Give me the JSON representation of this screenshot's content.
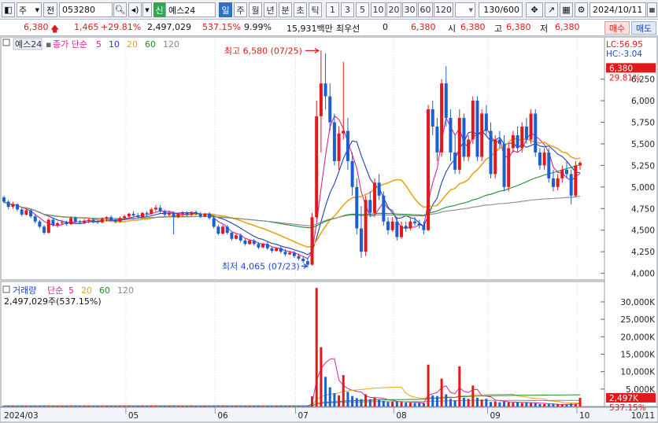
{
  "toolbar": {
    "market": "주",
    "jeon": "전",
    "code": "053280",
    "badge_new": "신",
    "name": "예스24",
    "periods": [
      "일",
      "주",
      "월",
      "년",
      "분",
      "초",
      "틱"
    ],
    "minutes": [
      "1",
      "3",
      "5",
      "10",
      "20",
      "30",
      "60",
      "120"
    ],
    "count": "130/600",
    "date": "2024/10/11"
  },
  "info": {
    "price": "6,380",
    "change": "1,465",
    "change_pct": "+29.81%",
    "volume": "2,497,029",
    "vol_pct": "537.15%",
    "turnover": "9.99%",
    "amount": "15,931백만",
    "best_bid_label": "최우선",
    "best_bid": "0",
    "best_ask": "6,380",
    "open_label": "시",
    "open": "6,380",
    "high_label": "고",
    "high": "6,380",
    "low_label": "저",
    "low": "6,380",
    "buy": "매수",
    "sell": "매도"
  },
  "price_panel": {
    "title": "예스24",
    "legend_prefix": "종가 단순",
    "ma_periods": [
      "5",
      "10",
      "20",
      "60",
      "120"
    ],
    "ma_colors": [
      "#d0269a",
      "#1c3fbf",
      "#e6a617",
      "#1d8f2c",
      "#8a8a8a"
    ],
    "lc": "LC:56.95",
    "hc": "HC:-3.04",
    "last_label": "6,380",
    "pct_label": "29.81%",
    "high_annot": "최고 6,580 (07/25)",
    "low_annot": "최저 4,065 (07/23)"
  },
  "volume_panel": {
    "title": "거래량",
    "legend_prefix": "단순",
    "ma_periods": [
      "5",
      "20",
      "60",
      "120"
    ],
    "ma_colors": [
      "#d0269a",
      "#e6a617",
      "#1d8f2c",
      "#8a8a8a"
    ],
    "volume_text": "2,497,029주(537.15%)",
    "last_label": "2,497K",
    "pct_label": "537.15%"
  },
  "x_axis": {
    "labels": [
      "2024/03",
      "05",
      "06",
      "07",
      "08",
      "09",
      "10"
    ],
    "right": "10/11"
  },
  "chart_data": [
    {
      "type": "candlestick",
      "title": "예스24",
      "y_ticks": [
        "6,250",
        "6,000",
        "5,750",
        "5,500",
        "5,250",
        "5,000",
        "4,750",
        "4,500",
        "4,250",
        "4,000"
      ],
      "ylim": [
        3960,
        6620
      ],
      "up_color": "#e0191b",
      "down_color": "#1c5fd0",
      "candles": [
        [
          4880,
          4900,
          4810,
          4830
        ],
        [
          4830,
          4850,
          4740,
          4770
        ],
        [
          4770,
          4830,
          4750,
          4800
        ],
        [
          4800,
          4810,
          4720,
          4740
        ],
        [
          4740,
          4760,
          4660,
          4680
        ],
        [
          4680,
          4750,
          4670,
          4730
        ],
        [
          4730,
          4740,
          4640,
          4660
        ],
        [
          4660,
          4680,
          4580,
          4600
        ],
        [
          4600,
          4620,
          4520,
          4540
        ],
        [
          4540,
          4560,
          4450,
          4470
        ],
        [
          4470,
          4640,
          4460,
          4620
        ],
        [
          4620,
          4640,
          4540,
          4560
        ],
        [
          4560,
          4600,
          4530,
          4580
        ],
        [
          4580,
          4620,
          4560,
          4590
        ],
        [
          4590,
          4610,
          4550,
          4570
        ],
        [
          4570,
          4660,
          4560,
          4640
        ],
        [
          4640,
          4660,
          4580,
          4600
        ],
        [
          4600,
          4620,
          4570,
          4590
        ],
        [
          4590,
          4630,
          4570,
          4610
        ],
        [
          4610,
          4640,
          4580,
          4620
        ],
        [
          4620,
          4640,
          4580,
          4600
        ],
        [
          4600,
          4620,
          4570,
          4590
        ],
        [
          4590,
          4650,
          4580,
          4630
        ],
        [
          4630,
          4660,
          4600,
          4650
        ],
        [
          4650,
          4670,
          4600,
          4620
        ],
        [
          4620,
          4640,
          4580,
          4600
        ],
        [
          4600,
          4660,
          4590,
          4640
        ],
        [
          4640,
          4680,
          4620,
          4660
        ],
        [
          4660,
          4700,
          4640,
          4690
        ],
        [
          4690,
          4720,
          4650,
          4670
        ],
        [
          4670,
          4700,
          4630,
          4650
        ],
        [
          4650,
          4710,
          4640,
          4700
        ],
        [
          4700,
          4720,
          4660,
          4690
        ],
        [
          4690,
          4760,
          4680,
          4740
        ],
        [
          4740,
          4790,
          4720,
          4760
        ],
        [
          4760,
          4790,
          4700,
          4720
        ],
        [
          4720,
          4740,
          4660,
          4680
        ],
        [
          4680,
          4720,
          4660,
          4700
        ],
        [
          4700,
          4720,
          4450,
          4650
        ],
        [
          4650,
          4700,
          4640,
          4690
        ],
        [
          4690,
          4720,
          4660,
          4700
        ],
        [
          4700,
          4720,
          4660,
          4680
        ],
        [
          4680,
          4720,
          4660,
          4710
        ],
        [
          4710,
          4730,
          4670,
          4690
        ],
        [
          4690,
          4710,
          4640,
          4660
        ],
        [
          4660,
          4700,
          4650,
          4690
        ],
        [
          4690,
          4710,
          4620,
          4640
        ],
        [
          4640,
          4660,
          4520,
          4540
        ],
        [
          4540,
          4560,
          4440,
          4460
        ],
        [
          4460,
          4560,
          4450,
          4540
        ],
        [
          4540,
          4560,
          4450,
          4470
        ],
        [
          4470,
          4480,
          4380,
          4400
        ],
        [
          4400,
          4460,
          4390,
          4440
        ],
        [
          4440,
          4460,
          4360,
          4380
        ],
        [
          4380,
          4400,
          4320,
          4340
        ],
        [
          4340,
          4390,
          4330,
          4380
        ],
        [
          4380,
          4400,
          4320,
          4340
        ],
        [
          4340,
          4360,
          4280,
          4300
        ],
        [
          4300,
          4350,
          4290,
          4340
        ],
        [
          4340,
          4360,
          4270,
          4290
        ],
        [
          4290,
          4310,
          4240,
          4260
        ],
        [
          4260,
          4300,
          4250,
          4290
        ],
        [
          4290,
          4310,
          4230,
          4250
        ],
        [
          4250,
          4280,
          4200,
          4220
        ],
        [
          4220,
          4260,
          4210,
          4240
        ],
        [
          4240,
          4260,
          4180,
          4200
        ],
        [
          4200,
          4230,
          4150,
          4170
        ],
        [
          4170,
          4200,
          4120,
          4140
        ],
        [
          4140,
          4180,
          4065,
          4100
        ],
        [
          4100,
          4700,
          4090,
          4650
        ],
        [
          4650,
          6000,
          4630,
          5820
        ],
        [
          5820,
          6580,
          5400,
          6200
        ],
        [
          6200,
          6550,
          5900,
          6050
        ],
        [
          6050,
          6200,
          5650,
          5750
        ],
        [
          5750,
          5850,
          5250,
          5300
        ],
        [
          5300,
          5700,
          5200,
          5620
        ],
        [
          5620,
          6450,
          5550,
          5650
        ],
        [
          5650,
          5800,
          5200,
          5300
        ],
        [
          5300,
          5400,
          4900,
          5000
        ],
        [
          5000,
          5100,
          4450,
          4520
        ],
        [
          4520,
          4780,
          4180,
          4250
        ],
        [
          4250,
          4900,
          4200,
          4850
        ],
        [
          4850,
          4950,
          4650,
          4700
        ],
        [
          4700,
          5100,
          4650,
          5050
        ],
        [
          5050,
          5150,
          4850,
          4900
        ],
        [
          4900,
          4950,
          4550,
          4600
        ],
        [
          4600,
          4650,
          4450,
          4500
        ],
        [
          4500,
          4650,
          4480,
          4600
        ],
        [
          4600,
          4650,
          4380,
          4420
        ],
        [
          4420,
          4600,
          4400,
          4550
        ],
        [
          4550,
          4600,
          4480,
          4520
        ],
        [
          4520,
          4650,
          4500,
          4600
        ],
        [
          4600,
          4650,
          4550,
          4580
        ],
        [
          4580,
          4620,
          4520,
          4560
        ],
        [
          4560,
          4600,
          4450,
          4500
        ],
        [
          4500,
          5950,
          4490,
          5900
        ],
        [
          5900,
          6000,
          5600,
          5700
        ],
        [
          5700,
          5800,
          5300,
          5400
        ],
        [
          5400,
          6250,
          5350,
          6200
        ],
        [
          6200,
          6400,
          5700,
          5800
        ],
        [
          5800,
          5900,
          5300,
          5400
        ],
        [
          5400,
          5600,
          5150,
          5200
        ],
        [
          5200,
          5900,
          5150,
          5800
        ],
        [
          5800,
          5850,
          5300,
          5350
        ],
        [
          5350,
          5600,
          5300,
          5550
        ],
        [
          5550,
          6050,
          5500,
          6000
        ],
        [
          6000,
          6050,
          5300,
          5350
        ],
        [
          5350,
          5900,
          5300,
          5850
        ],
        [
          5850,
          5950,
          5600,
          5650
        ],
        [
          5650,
          5750,
          5100,
          5150
        ],
        [
          5150,
          5600,
          5100,
          5550
        ],
        [
          5550,
          5650,
          5450,
          5500
        ],
        [
          5500,
          5600,
          4950,
          5000
        ],
        [
          5000,
          5500,
          4950,
          5450
        ],
        [
          5450,
          5650,
          5400,
          5600
        ],
        [
          5600,
          5700,
          5400,
          5450
        ],
        [
          5450,
          5750,
          5400,
          5700
        ],
        [
          5700,
          5800,
          5500,
          5550
        ],
        [
          5550,
          5900,
          5500,
          5850
        ],
        [
          5850,
          5900,
          5350,
          5400
        ],
        [
          5400,
          5450,
          5200,
          5250
        ],
        [
          5250,
          5450,
          5200,
          5400
        ],
        [
          5400,
          5450,
          5050,
          5100
        ],
        [
          5100,
          5200,
          4950,
          5000
        ],
        [
          5000,
          5150,
          4960,
          5100
        ],
        [
          5100,
          5250,
          5050,
          5200
        ],
        [
          5200,
          5300,
          5100,
          5150
        ],
        [
          5150,
          5200,
          4800,
          4900
        ],
        [
          4900,
          5300,
          4880,
          5250
        ],
        [
          5250,
          5300,
          5200,
          5280
        ]
      ],
      "high_point": {
        "label": "최고 6,580 (07/25)",
        "value": 6580
      },
      "low_point": {
        "label": "최저 4,065 (07/23)",
        "value": 4065
      }
    },
    {
      "type": "bar",
      "title": "거래량",
      "y_ticks": [
        "30,000K",
        "25,000K",
        "20,000K",
        "15,000K",
        "10,000K",
        "5,000K"
      ],
      "ylim": [
        0,
        34500
      ],
      "units": "K shares",
      "values": [
        180,
        170,
        160,
        150,
        170,
        160,
        150,
        160,
        170,
        180,
        210,
        170,
        160,
        150,
        160,
        200,
        170,
        160,
        160,
        170,
        160,
        150,
        160,
        180,
        170,
        160,
        170,
        180,
        180,
        170,
        160,
        180,
        170,
        200,
        220,
        180,
        170,
        170,
        260,
        170,
        160,
        160,
        170,
        160,
        150,
        160,
        160,
        180,
        200,
        190,
        180,
        190,
        170,
        180,
        170,
        160,
        170,
        180,
        170,
        160,
        170,
        160,
        170,
        160,
        170,
        180,
        170,
        160,
        220,
        2900,
        34000,
        17000,
        8500,
        5500,
        3800,
        3200,
        9000,
        4200,
        3000,
        2400,
        2100,
        3500,
        2100,
        2600,
        2000,
        1600,
        1300,
        1400,
        1400,
        1300,
        1100,
        1100,
        1000,
        1000,
        900,
        12000,
        3200,
        3000,
        8000,
        3500,
        2200,
        1800,
        11500,
        2500,
        2200,
        6000,
        2500,
        2000,
        2200,
        1300,
        1500,
        1200,
        1400,
        1200,
        1100,
        1200,
        1000,
        1200,
        1000,
        950,
        700,
        700,
        650,
        650,
        600,
        550,
        550,
        850,
        750,
        2497
      ]
    }
  ]
}
